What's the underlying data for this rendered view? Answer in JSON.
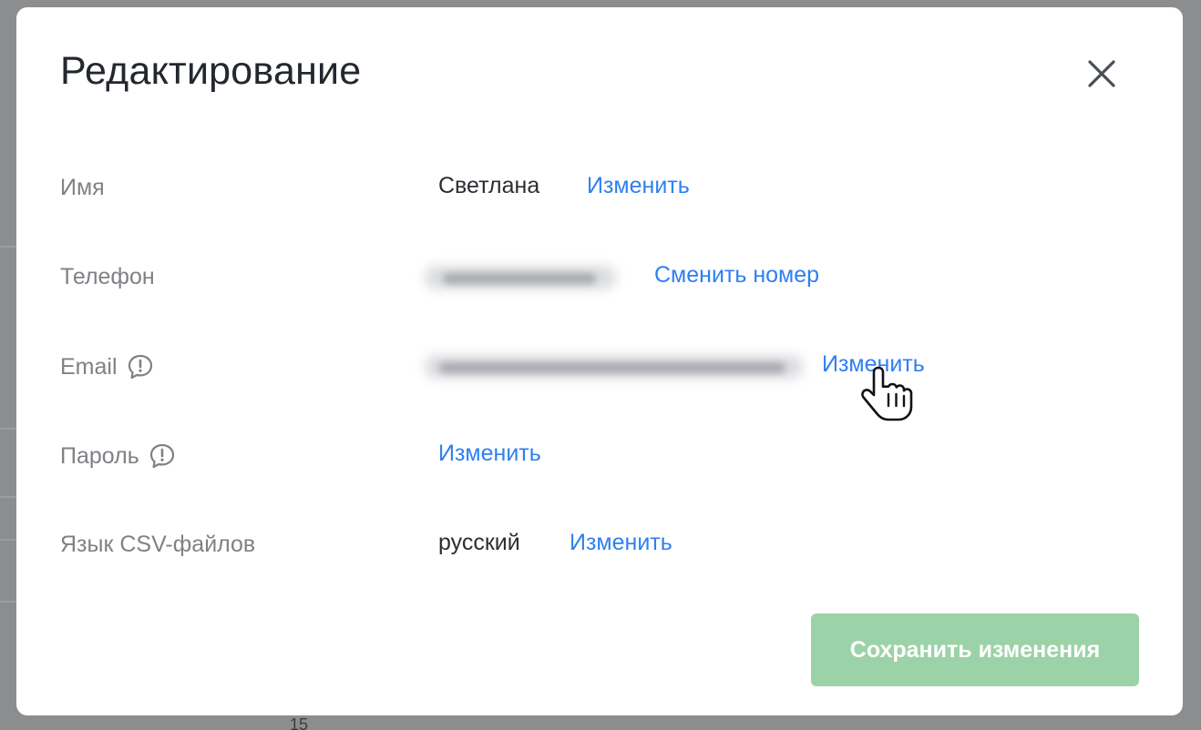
{
  "modal": {
    "title": "Редактирование"
  },
  "rows": {
    "name": {
      "label": "Имя",
      "value": "Светлана",
      "action": "Изменить"
    },
    "phone": {
      "label": "Телефон",
      "action": "Сменить номер"
    },
    "email": {
      "label": "Email",
      "action": "Изменить"
    },
    "password": {
      "label": "Пароль",
      "action": "Изменить"
    },
    "csv_lang": {
      "label": "Язык CSV-файлов",
      "value": "русский",
      "action": "Изменить"
    }
  },
  "footer": {
    "save_label": "Сохранить изменения"
  },
  "background": {
    "partial_number": "15"
  },
  "colors": {
    "link": "#2f7ff0",
    "save_button": "#9cd2a8",
    "title": "#23272e",
    "label": "#7f8186",
    "overlay": "#8f9092"
  },
  "icons": {
    "close": "close-icon",
    "email_info": "speech-bubble-exclamation-icon",
    "password_info": "speech-bubble-exclamation-icon",
    "cursor": "hand-pointer-cursor-icon"
  }
}
